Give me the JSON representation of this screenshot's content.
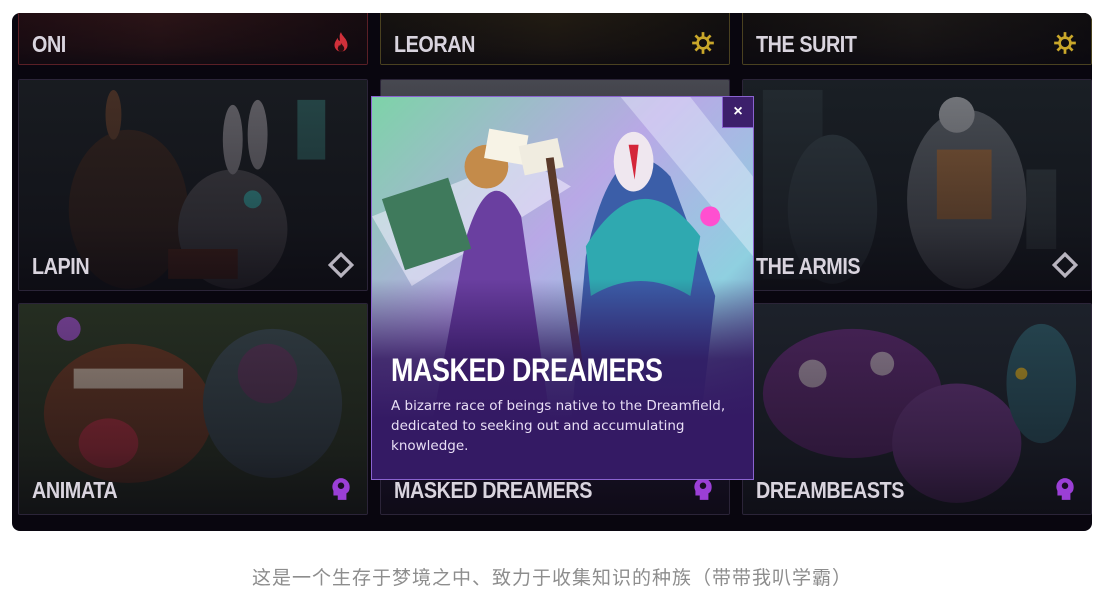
{
  "cards": [
    {
      "label": "ONI",
      "icon": "flame-icon"
    },
    {
      "label": "LEORAN",
      "icon": "sun-gear-icon"
    },
    {
      "label": "THE SURIT",
      "icon": "sun-gear-icon"
    },
    {
      "label": "LAPIN",
      "icon": "diamond-icon"
    },
    {
      "label": "THE ARMIS",
      "icon": "diamond-icon"
    },
    {
      "label": "ANIMATA",
      "icon": "mind-head-icon"
    },
    {
      "label": "MASKED DREAMERS",
      "icon": "mind-head-icon"
    },
    {
      "label": "DREAMBEASTS",
      "icon": "mind-head-icon"
    }
  ],
  "modal": {
    "title": "MASKED DREAMERS",
    "description": "A bizarre race of beings native to the Dreamfield, dedicated to seeking out and accumulating knowledge.",
    "close_label": "×"
  },
  "caption": "这是一个生存于梦境之中、致力于收集知识的种族（带带我叭学霸）",
  "colors": {
    "frame_bg": "#09060f",
    "modal_bg": "#341a64",
    "modal_border": "#8a63d0",
    "oni_accent": "#d0303a",
    "leoran_accent": "#c9a72a",
    "dream_accent": "#9b3fd6",
    "neutral_icon": "#b8b4bf"
  }
}
